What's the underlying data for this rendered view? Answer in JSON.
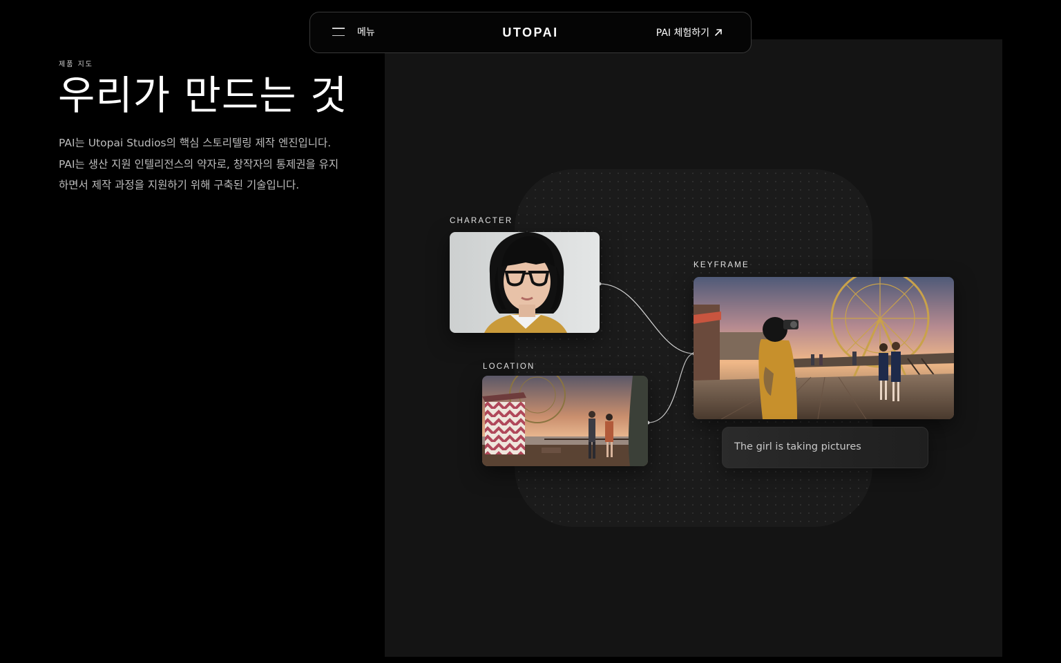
{
  "nav": {
    "menu_label": "메뉴",
    "logo": "UTOPAI",
    "cta_label": "PAI 체험하기",
    "menu_icon": "hamburger-icon",
    "cta_icon": "arrow-up-right-icon"
  },
  "hero": {
    "eyebrow": "제품 지도",
    "title": "우리가 만드는 것",
    "description_lines": [
      "PAI는 Utopai Studios의 핵심 스토리텔링 제작 엔진입니다.",
      "PAI는 생산 지원 인텔리전스의 약자로, 창작자의 통제권을 유지",
      "하면서 제작 과정을 지원하기 위해 구축된 기술입니다."
    ]
  },
  "diagram": {
    "character_label": "CHARACTER",
    "location_label": "LOCATION",
    "keyframe_label": "KEYFRAME",
    "caption": "The girl is taking pictures"
  },
  "colors": {
    "background": "#000000",
    "panel": "#141414",
    "accent_text": "#ffffff",
    "muted_text": "#bdbdbd"
  }
}
